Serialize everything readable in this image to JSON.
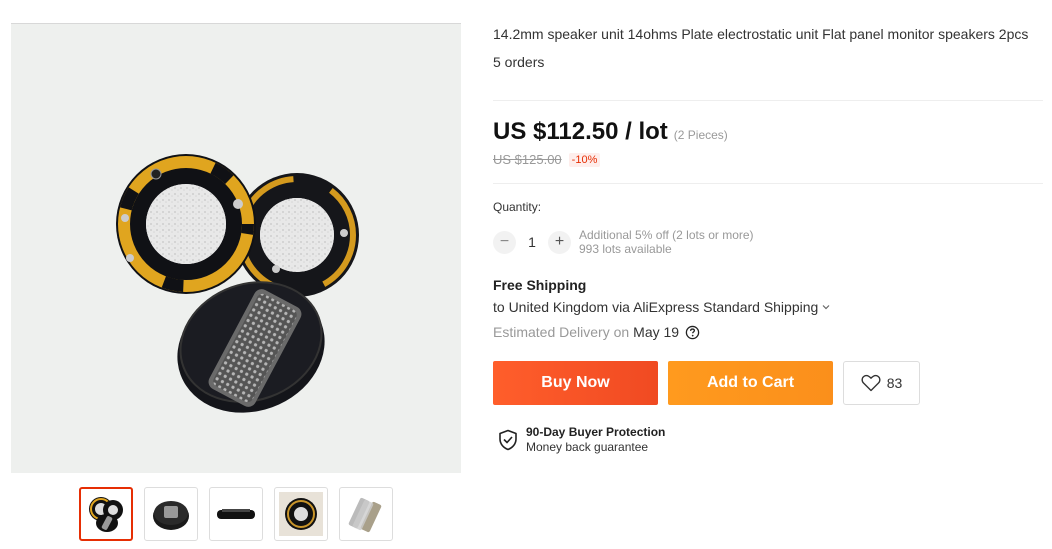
{
  "product": {
    "title": "14.2mm speaker unit 14ohms Plate electrostatic unit Flat panel monitor speakers 2pcs",
    "orders": "5 orders"
  },
  "price": {
    "current": "US $112.50 / lot",
    "pieces": "(2 Pieces)",
    "original": "US $125.00",
    "discount": "-10%"
  },
  "quantity": {
    "label": "Quantity:",
    "value": "1",
    "decrement": "−",
    "increment": "+",
    "offer": "Additional 5% off (2 lots or more)",
    "available": "993 lots available"
  },
  "shipping": {
    "title": "Free Shipping",
    "destination": "to United Kingdom via AliExpress Standard Shipping",
    "delivery_label": "Estimated Delivery on",
    "delivery_date": "May 19"
  },
  "actions": {
    "buy_now": "Buy Now",
    "add_to_cart": "Add to Cart",
    "wishlist_count": "83"
  },
  "protection": {
    "title": "90-Day Buyer Protection",
    "subtitle": "Money back guarantee"
  },
  "gallery": {
    "thumbnails": [
      "thumb-1",
      "thumb-2",
      "thumb-3",
      "thumb-4",
      "thumb-5"
    ],
    "selected": 0
  },
  "colors": {
    "buy_now": "#f04a22",
    "add_to_cart": "#fb8f1b",
    "discount": "#e62e04"
  },
  "icons": {
    "wishlist": "heart-icon",
    "protection": "shield-check-icon",
    "help": "question-circle-icon",
    "dropdown": "chevron-down-icon"
  }
}
